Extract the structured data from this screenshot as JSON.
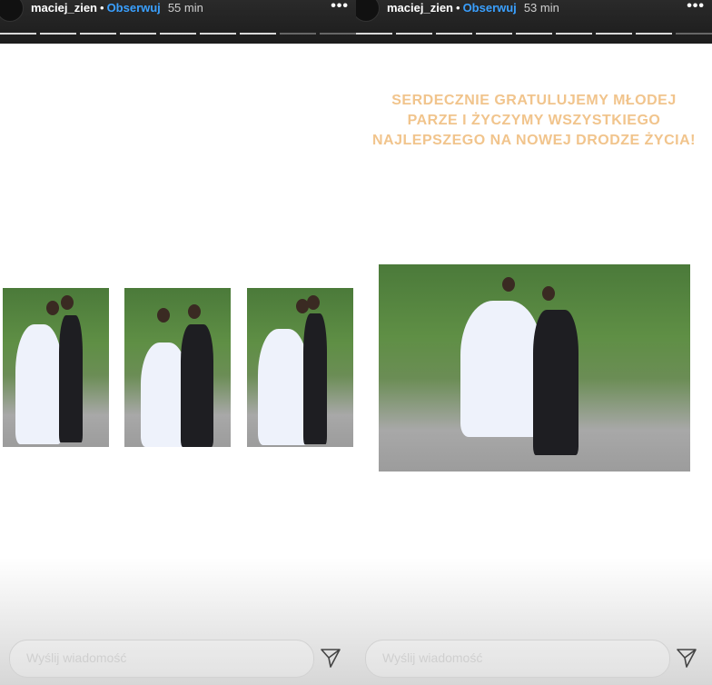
{
  "stories": [
    {
      "username": "maciej_zien",
      "separator": "•",
      "follow_label": "Obserwuj",
      "time": "55 min",
      "more": "•••",
      "message_placeholder": "Wyślij wiadomość",
      "progress_segments": 9,
      "active_segment": 8
    },
    {
      "username": "maciej_zien",
      "separator": "•",
      "follow_label": "Obserwuj",
      "time": "53 min",
      "more": "•••",
      "message_placeholder": "Wyślij wiadomość",
      "progress_segments": 9,
      "active_segment": 9,
      "greeting_lines": [
        "SERDECZNIE GRATULUJEMY MŁODEJ",
        "PARZE I ŻYCZYMY WSZYSTKIEGO",
        "NAJLEPSZEGO NA NOWEJ DRODZE ŻYCIA!"
      ]
    }
  ],
  "colors": {
    "header_bg": "#1c1c1c",
    "follow": "#3aa0ff",
    "greeting": "#f1c48c",
    "placeholder": "#cfcfcf"
  },
  "icons": {
    "send": "paper-plane-icon",
    "more": "more-options-icon"
  }
}
